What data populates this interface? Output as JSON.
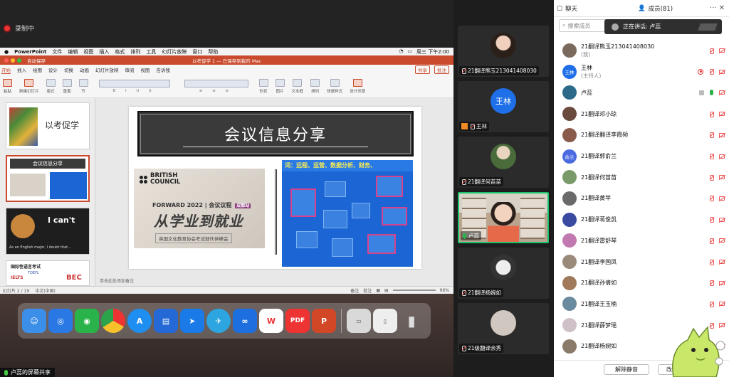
{
  "recording": {
    "label": "录制中"
  },
  "mac_menu": {
    "app": "PowerPoint",
    "items": [
      "文件",
      "编辑",
      "视图",
      "插入",
      "格式",
      "排列",
      "工具",
      "幻灯片放映",
      "窗口",
      "帮助"
    ],
    "clock": "周三 下午2:00"
  },
  "ppt": {
    "autosave": "自动保存",
    "doc_title": "以考促学 1 — 已保存到我的 Mac",
    "tabs": [
      "开始",
      "插入",
      "绘图",
      "设计",
      "切换",
      "动画",
      "幻灯片放映",
      "审阅",
      "视图",
      "告诉我"
    ],
    "share": "共享",
    "comment": "批注",
    "ribbon": [
      "粘贴",
      "新建幻灯片",
      "版式",
      "重置",
      "节",
      "形状",
      "图片",
      "文本框",
      "排列",
      "快速样式",
      "设计灵感"
    ],
    "thumbs": [
      {
        "num": "1",
        "title": "以考促学"
      },
      {
        "num": "2",
        "title": "会议信息分享"
      },
      {
        "num": "3",
        "title": "I can't",
        "caption": "As an English major, I doubt that..."
      },
      {
        "num": "4",
        "title": "国际性语言考试",
        "logos": [
          "IELTS",
          "TOEFL",
          "BEC"
        ]
      }
    ],
    "slide": {
      "title": "会议信息分享",
      "photo1": {
        "brand_line1": "BRITISH",
        "brand_line2": "COUNCIL",
        "forward": "FORWARD 2022 | 会议议程",
        "forward_badge": "成都站",
        "headline": "从学业到就业",
        "sub": "英国文化教育协会考试部伙伴峰会"
      },
      "photo2": {
        "banner": "词：远程、运营、数据分析、财务、"
      }
    },
    "notes_placeholder": "单击此处添加备注",
    "status": {
      "slide_of": "幻灯片 2 / 19",
      "lang": "中文(中国)",
      "notes": "备注",
      "comments": "批注",
      "zoom": "96%"
    }
  },
  "dock": {
    "apps": [
      "finder",
      "safari",
      "wechat",
      "chrome",
      "app-store",
      "tasks",
      "lark",
      "telegram",
      "tencent-meeting",
      "wps",
      "pdf",
      "powerpoint"
    ]
  },
  "share_label": "卢蕊的屏幕共享",
  "gallery": [
    {
      "name": "21翻译熊玉213041408030"
    },
    {
      "name": "王林",
      "initials": "王林"
    },
    {
      "name": "21翻译何苗苗"
    },
    {
      "name": "卢蕊"
    },
    {
      "name": "21翻译杨婉如"
    },
    {
      "name": "21级翻译余秀"
    }
  ],
  "panel": {
    "tab_chat": "聊天",
    "tab_members": "成员(81)",
    "search_placeholder": "搜索成员",
    "speaking": "正在讲话: 卢蕊",
    "members": [
      {
        "name": "21翻译熊玉213041408030",
        "role": "(我)"
      },
      {
        "name": "王林",
        "role": "(主持人)",
        "avatar_text": "王林"
      },
      {
        "name": "卢蕊"
      },
      {
        "name": "21翻译邓小琼"
      },
      {
        "name": "21翻译翻译李霞频"
      },
      {
        "name": "21翻译郭俞兰",
        "avatar_text": "俞兰"
      },
      {
        "name": "21翻译何苗苗"
      },
      {
        "name": "21翻译黄苹"
      },
      {
        "name": "21翻译蒋俊凯"
      },
      {
        "name": "21翻译雷舒琴"
      },
      {
        "name": "21翻译李国凤"
      },
      {
        "name": "21翻译孙倩如"
      },
      {
        "name": "21翻译王玉楠"
      },
      {
        "name": "21翻译薛梦瑶"
      },
      {
        "name": "21翻译杨婉如"
      }
    ],
    "unmute_all": "解除静音",
    "more": "改名"
  },
  "colors": {
    "accent": "#c94a2c",
    "active_border": "#19c36a",
    "host_blue": "#1e6fe8"
  }
}
